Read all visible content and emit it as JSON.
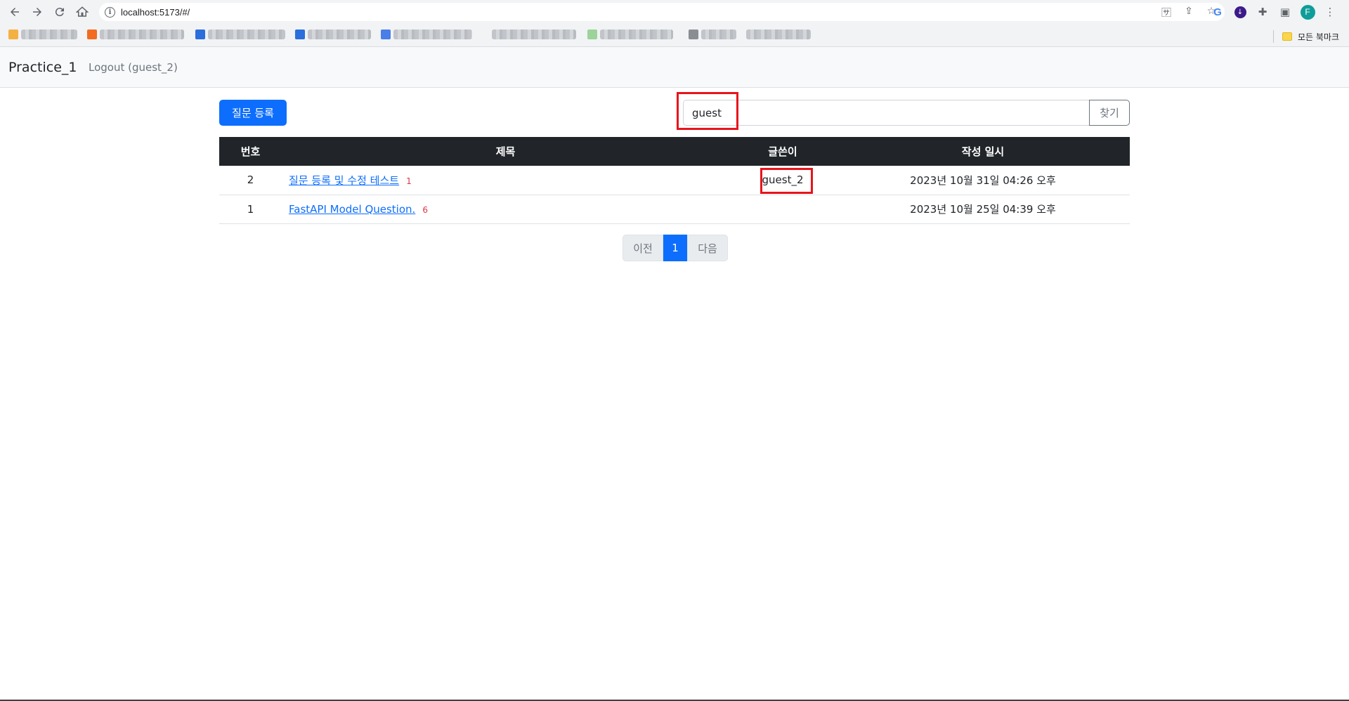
{
  "browser": {
    "url": "localhost:5173/#/",
    "all_bookmarks_label": "모든 북마크",
    "profile_initial": "F"
  },
  "navbar": {
    "brand": "Practice_1",
    "logout_link": "Logout (guest_2)"
  },
  "toolbar": {
    "create_button": "질문 등록",
    "search_value": "guest",
    "search_button": "찾기"
  },
  "table": {
    "headers": [
      "번호",
      "제목",
      "글쓴이",
      "작성 일시"
    ],
    "rows": [
      {
        "number": "2",
        "subject": "질문 등록 및 수정 테스트",
        "answer_count": "1",
        "author": "guest_2",
        "date": "2023년 10월 31일 04:26 오후"
      },
      {
        "number": "1",
        "subject": "FastAPI Model Question.",
        "answer_count": "6",
        "author": "",
        "date": "2023년 10월 25일 04:39 오후"
      }
    ]
  },
  "pagination": {
    "prev": "이전",
    "current": "1",
    "next": "다음"
  },
  "colors": {
    "primary": "#0d6efd",
    "table_header": "#212529",
    "highlight": "#e8141b",
    "answer_count": "#dc3545"
  }
}
